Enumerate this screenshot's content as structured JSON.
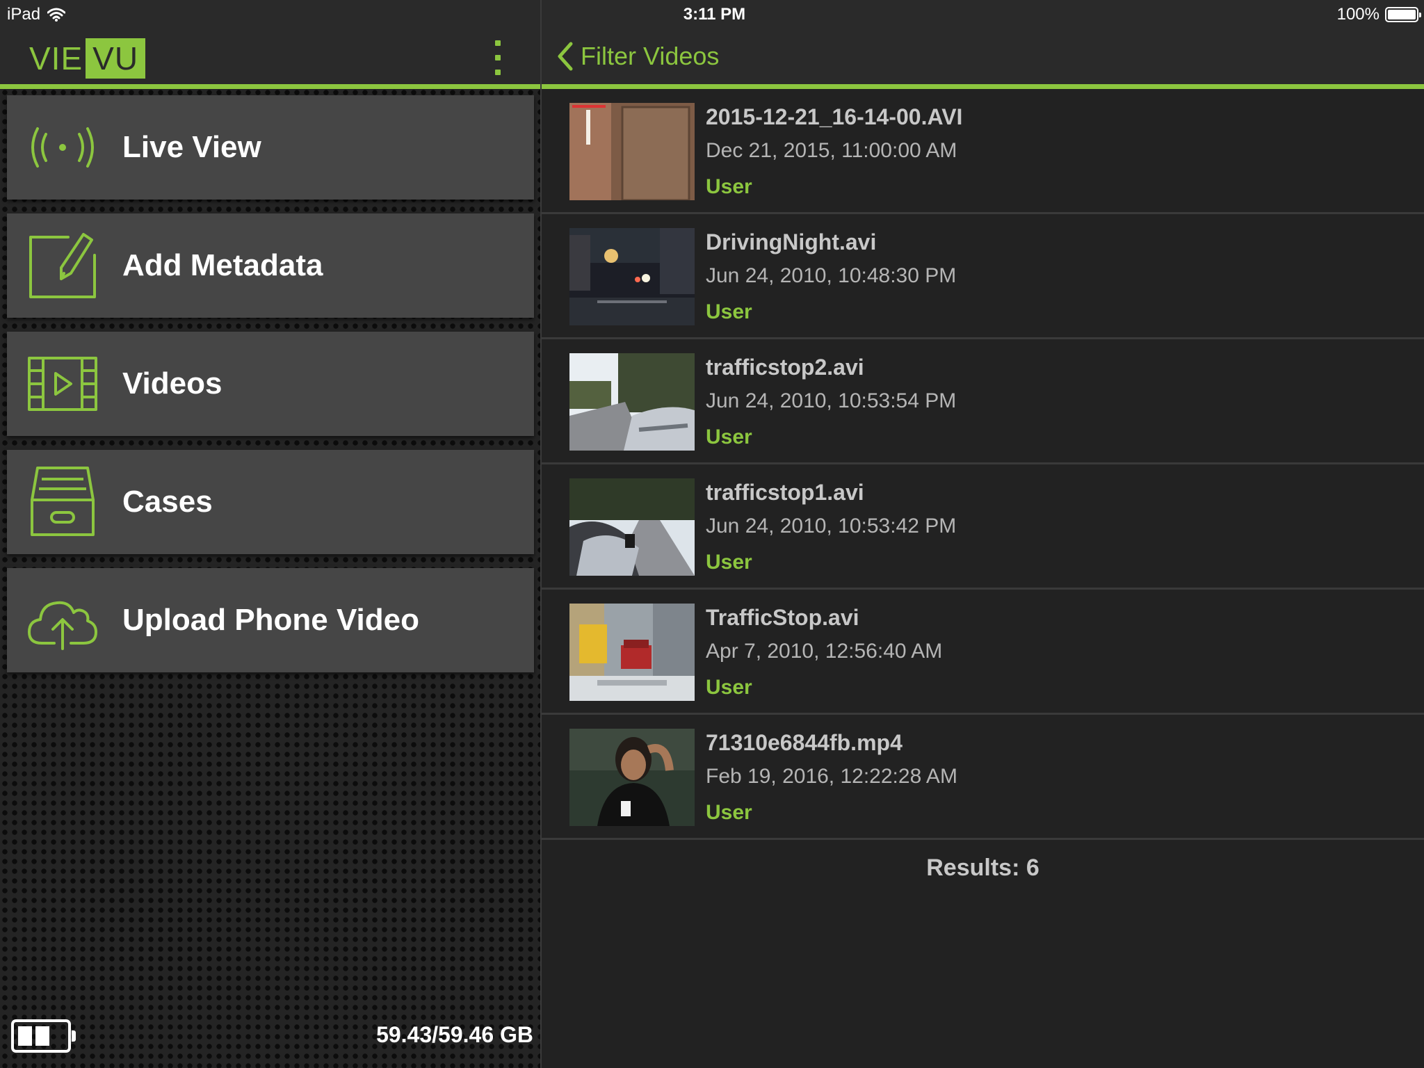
{
  "status_bar": {
    "device": "iPad",
    "time": "3:11 PM",
    "battery_percent": "100%",
    "icons": [
      "wifi-icon",
      "battery-icon"
    ]
  },
  "sidebar": {
    "logo_left": "VIE",
    "logo_right": "VU",
    "menu_icon": "kebab-menu-icon",
    "items": [
      {
        "label": "Live View",
        "icon": "live-broadcast-icon"
      },
      {
        "label": "Add Metadata",
        "icon": "edit-pencil-icon"
      },
      {
        "label": "Videos",
        "icon": "film-strip-icon"
      },
      {
        "label": "Cases",
        "icon": "archive-box-icon"
      },
      {
        "label": "Upload Phone Video",
        "icon": "cloud-upload-icon"
      }
    ],
    "footer": {
      "camera_battery_icon": "camera-battery-icon",
      "storage": "59.43/59.46 GB"
    }
  },
  "main": {
    "back_label": "Filter Videos",
    "back_icon": "chevron-left-icon",
    "videos": [
      {
        "name": "2015-12-21_16-14-00.AVI",
        "date": "Dec 21, 2015, 11:00:00 AM",
        "owner": "User",
        "thumb": "door-interior"
      },
      {
        "name": "DrivingNight.avi",
        "date": "Jun 24, 2010, 10:48:30 PM",
        "owner": "User",
        "thumb": "night-street"
      },
      {
        "name": "trafficstop2.avi",
        "date": "Jun 24, 2010, 10:53:54 PM",
        "owner": "User",
        "thumb": "road-trees"
      },
      {
        "name": "trafficstop1.avi",
        "date": "Jun 24, 2010, 10:53:42 PM",
        "owner": "User",
        "thumb": "road-car-window"
      },
      {
        "name": "TrafficStop.avi",
        "date": "Apr 7, 2010, 12:56:40 AM",
        "owner": "User",
        "thumb": "city-street"
      },
      {
        "name": "71310e6844fb.mp4",
        "date": "Feb 19, 2016, 12:22:28 AM",
        "owner": "User",
        "thumb": "person-portrait"
      }
    ],
    "results_label": "Results: 6"
  },
  "colors": {
    "accent": "#8cc63f",
    "panel_bg": "#222222",
    "menu_item_bg": "#464646",
    "header_bg": "#2a2a2a"
  }
}
